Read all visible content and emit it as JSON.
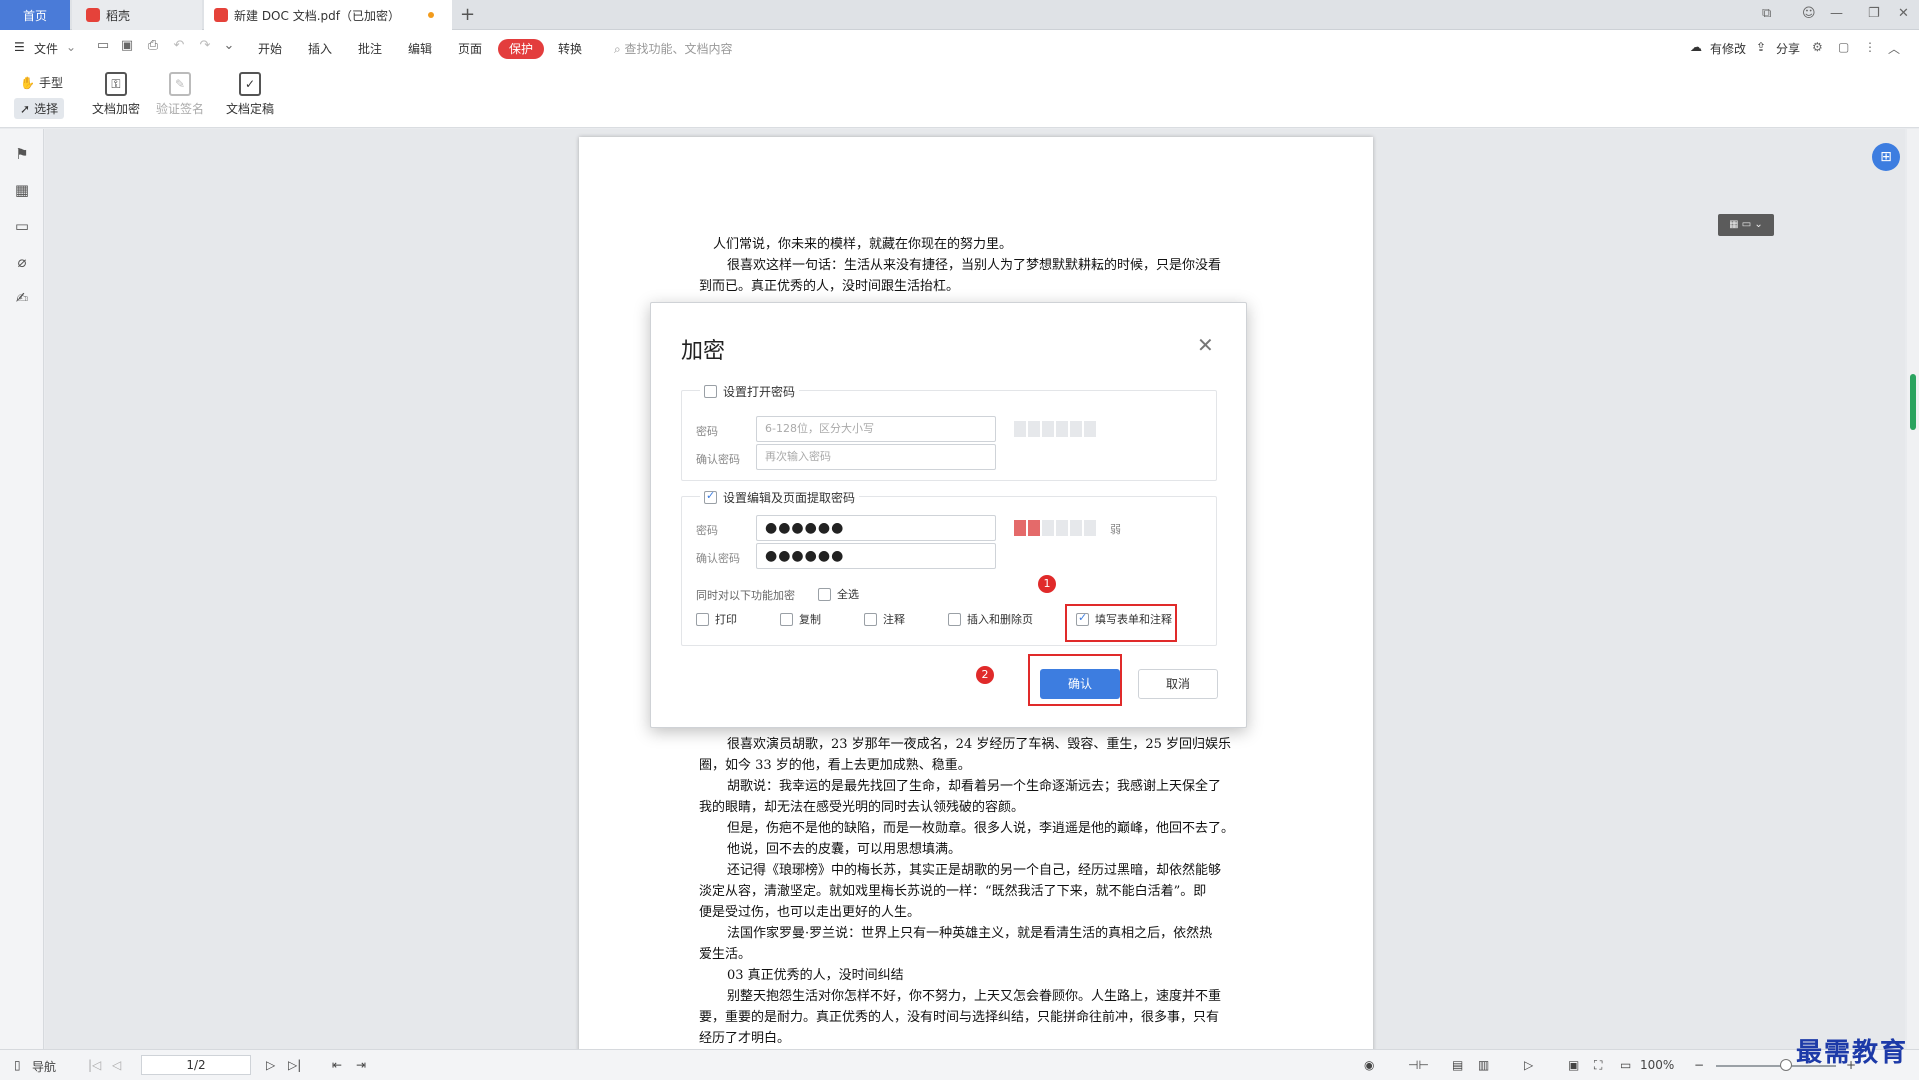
{
  "tabs": {
    "home": "首页",
    "daoke": "稻壳",
    "doc": "新建 DOC 文档.pdf（已加密）",
    "new_tab": "+"
  },
  "menubar": {
    "file": "文件",
    "items": [
      "开始",
      "插入",
      "批注",
      "编辑",
      "页面",
      "保护",
      "转换"
    ],
    "active": "保护",
    "search_placeholder": "查找功能、文档内容",
    "right": {
      "modified": "有修改",
      "share": "分享"
    }
  },
  "ribbon": {
    "hand": "手型",
    "select": "选择",
    "encrypt": "文档加密",
    "verify_sign": "验证签名",
    "finalize": "文档定稿"
  },
  "document": {
    "lines_top": [
      "人们常说，你未来的模样，就藏在你现在的努力里。",
      "很喜欢这样一句话：生活从来没有捷径，当别人为了梦想默默耕耘的时候，只是你没看",
      "到而已。真正优秀的人，没时间跟生活抬杠。"
    ],
    "lines_bottom": [
      "很喜欢演员胡歌，23 岁那年一夜成名，24 岁经历了车祸、毁容、重生，25 岁回归娱乐",
      "圈，如今 33 岁的他，看上去更加成熟、稳重。",
      "胡歌说：我幸运的是最先找回了生命，却看着另一个生命逐渐远去；我感谢上天保全了",
      "我的眼睛，却无法在感受光明的同时去认领残破的容颜。",
      "但是，伤疤不是他的缺陷，而是一枚勋章。很多人说，李逍遥是他的巅峰，他回不去了。",
      "他说，回不去的皮囊，可以用思想填满。",
      "还记得《琅琊榜》中的梅长苏，其实正是胡歌的另一个自己，经历过黑暗，却依然能够",
      "淡定从容，清澈坚定。就如戏里梅长苏说的一样：“既然我活了下来，就不能白活着”。即",
      "便是受过伤，也可以走出更好的人生。",
      "法国作家罗曼·罗兰说：世界上只有一种英雄主义，就是看清生活的真相之后，依然热",
      "爱生活。",
      "03  真正优秀的人，没时间纠结",
      "别整天抱怨生活对你怎样不好，你不努力，上天又怎会眷顾你。人生路上，速度并不重",
      "要，重要的是耐力。真正优秀的人，没有时间与选择纠结，只能拼命往前冲，很多事，只有",
      "经历了才明白。"
    ]
  },
  "dialog": {
    "title": "加密",
    "open_pwd": {
      "label": "设置打开密码",
      "checked": false,
      "pwd_label": "密码",
      "pwd_placeholder": "6-128位，区分大小写",
      "confirm_label": "确认密码",
      "confirm_placeholder": "再次输入密码"
    },
    "edit_pwd": {
      "label": "设置编辑及页面提取密码",
      "checked": true,
      "pwd_label": "密码",
      "pwd_value": "●●●●●●",
      "confirm_label": "确认密码",
      "confirm_value": "●●●●●●",
      "strength": "弱",
      "strength_level": 2,
      "also_encrypt": "同时对以下功能加密",
      "select_all": "全选",
      "options": [
        {
          "label": "打印",
          "checked": false
        },
        {
          "label": "复制",
          "checked": false
        },
        {
          "label": "注释",
          "checked": false
        },
        {
          "label": "插入和删除页",
          "checked": false
        },
        {
          "label": "填写表单和注释",
          "checked": true
        }
      ]
    },
    "ok": "确认",
    "cancel": "取消",
    "badges": [
      "1",
      "2"
    ]
  },
  "statusbar": {
    "nav": "导航",
    "page": "1/2",
    "zoom": "100%"
  },
  "watermark": "最需教育",
  "colors": {
    "accent": "#3d7de0",
    "protect_tab": "#e33d3d",
    "highlight": "#e02a2a",
    "strength_weak": "#e46a6a"
  }
}
